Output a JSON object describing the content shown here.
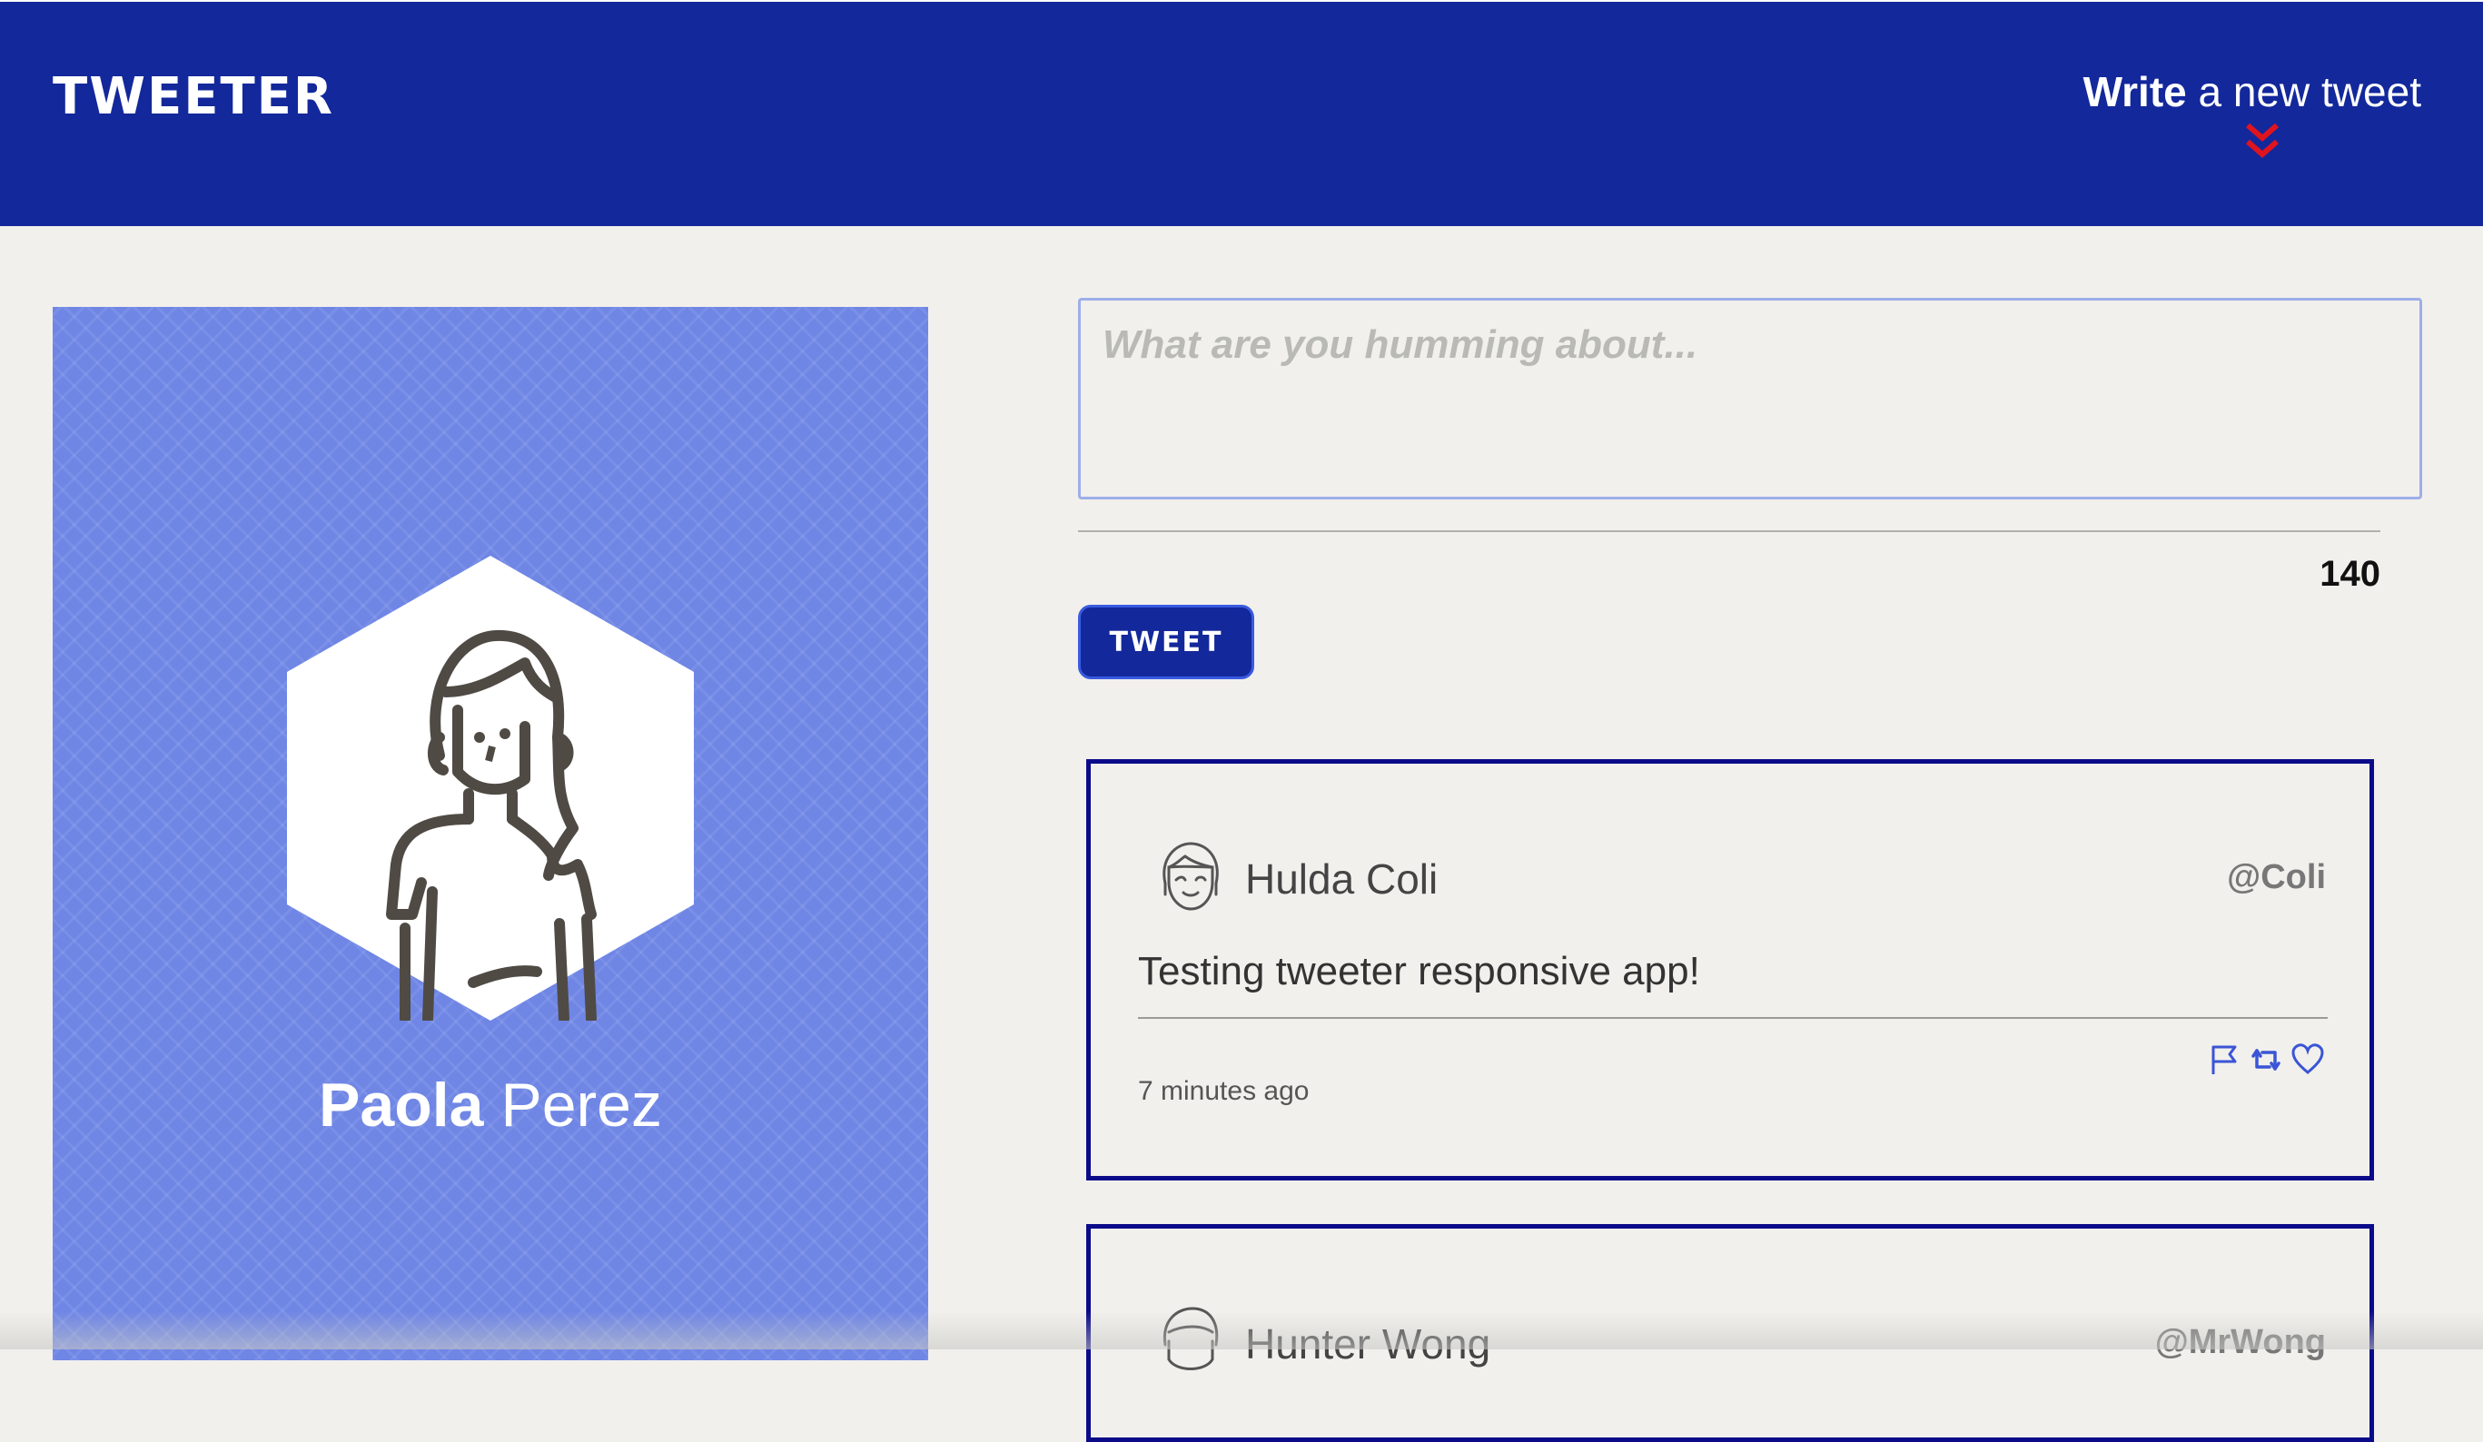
{
  "nav": {
    "brand": "TWEETER",
    "write_strong": "Write",
    "write_rest": " a new tweet"
  },
  "profile": {
    "first_name": "Paola",
    "last_name": "Perez"
  },
  "compose": {
    "placeholder": "What are you humming about...",
    "counter": "140",
    "button_label": "TWEET"
  },
  "tweets": [
    {
      "name": "Hulda Coli",
      "handle": "@Coli",
      "text": "Testing tweeter responsive app!",
      "time": "7 minutes ago"
    },
    {
      "name": "Hunter Wong",
      "handle": "@MrWong"
    }
  ],
  "colors": {
    "nav_bg": "#13289b",
    "accent_red": "#e0141e",
    "profile_bg": "#6f86e5",
    "card_border": "#0b0b8a",
    "action_icons": "#3a55d6"
  },
  "icons": [
    "double-chevron-down-icon",
    "flag-icon",
    "retweet-icon",
    "heart-icon"
  ]
}
